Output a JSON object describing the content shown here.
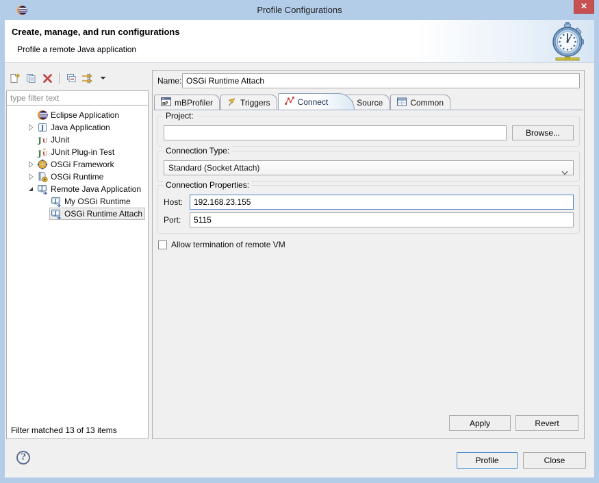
{
  "window": {
    "title": "Profile Configurations",
    "close_glyph": "✕"
  },
  "header": {
    "title": "Create, manage, and run configurations",
    "subtitle": "Profile a remote Java application"
  },
  "left_panel": {
    "toolbar_icons": [
      "new-configuration",
      "duplicate-configuration",
      "delete-configuration",
      "collapse-all",
      "filter-configurations",
      "view-menu"
    ],
    "filter_placeholder": "type filter text",
    "tree": [
      {
        "label": "Eclipse Application",
        "icon": "eclipse",
        "state": "leaf",
        "level": 1,
        "selected": false
      },
      {
        "label": "Java Application",
        "icon": "java-application",
        "state": "collapsed",
        "level": 1,
        "selected": false
      },
      {
        "label": "JUnit",
        "icon": "junit",
        "state": "leaf",
        "level": 1,
        "selected": false
      },
      {
        "label": "JUnit Plug-in Test",
        "icon": "junit-plugin-test",
        "state": "leaf",
        "level": 1,
        "selected": false
      },
      {
        "label": "OSGi Framework",
        "icon": "osgi-framework",
        "state": "collapsed",
        "level": 1,
        "selected": false
      },
      {
        "label": "OSGi Runtime",
        "icon": "osgi-runtime",
        "state": "collapsed",
        "level": 1,
        "selected": false
      },
      {
        "label": "Remote Java Application",
        "icon": "remote-java-application",
        "state": "expanded",
        "level": 1,
        "selected": false
      },
      {
        "label": "My OSGi Runtime",
        "icon": "remote-java-application",
        "state": "leaf",
        "level": 2,
        "selected": false
      },
      {
        "label": "OSGi Runtime Attach",
        "icon": "remote-java-application",
        "state": "leaf",
        "level": 2,
        "selected": true
      }
    ],
    "status": "Filter matched 13 of 13 items"
  },
  "main": {
    "name_label": "Name:",
    "name_value": "OSGi Runtime Attach",
    "tabs": [
      {
        "label": "mBProfiler",
        "icon": "mbprofiler-icon",
        "active": false
      },
      {
        "label": "Triggers",
        "icon": "triggers-icon",
        "active": false
      },
      {
        "label": "Connect",
        "icon": "connect-icon",
        "active": true
      },
      {
        "label": "Source",
        "icon": "source-icon",
        "active": false
      },
      {
        "label": "Common",
        "icon": "common-icon",
        "active": false
      }
    ],
    "project": {
      "legend": "Project:",
      "value": "",
      "browse_label": "Browse..."
    },
    "connection_type": {
      "legend": "Connection Type:",
      "value": "Standard (Socket Attach)"
    },
    "connection_properties": {
      "legend": "Connection Properties:",
      "host_label": "Host:",
      "host_value": "192.168.23.155",
      "port_label": "Port:",
      "port_value": "5115"
    },
    "allow_termination_label": "Allow termination of remote VM",
    "apply_label": "Apply",
    "revert_label": "Revert"
  },
  "footer": {
    "help_glyph": "?",
    "profile_label": "Profile",
    "close_label": "Close"
  },
  "colors": {
    "titlebar": "#b3cde9",
    "close_button_red": "#c75050",
    "dialog_background": "#f0f0f0",
    "focus_border_blue": "#4f84c2",
    "default_button_border": "#4f8fd0",
    "selection_background": "#ececec"
  }
}
